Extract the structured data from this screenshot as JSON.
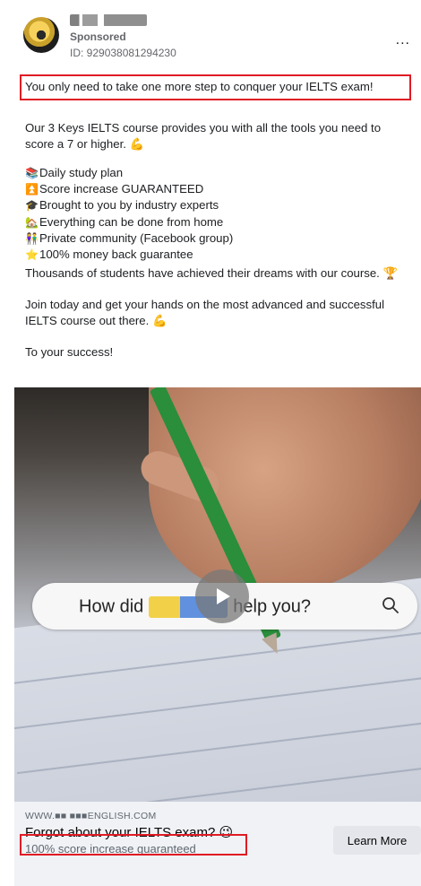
{
  "post": {
    "sponsored": "Sponsored",
    "ad_id": "ID: 929038081294230",
    "more_label": "...",
    "intro": "You only need to take one more step to conquer your IELTS exam!",
    "paragraph1": "Our 3 Keys IELTS course provides you with all the tools you need to score a 7 or higher. 💪",
    "list": [
      {
        "emoji": "📚",
        "text": "Daily study plan"
      },
      {
        "emoji": "⏫",
        "text": "Score increase GUARANTEED"
      },
      {
        "emoji": "🎓",
        "text": "Brought to you by industry experts"
      },
      {
        "emoji": "🏡",
        "text": "Everything can be done from home"
      },
      {
        "emoji": "👫",
        "text": "Private community (Facebook group)"
      },
      {
        "emoji": "⭐",
        "text": "100% money back guarantee"
      }
    ],
    "paragraph2": "Thousands of students have achieved their dreams with our course. 🏆",
    "paragraph3": "Join today and get your hands on the most advanced and successful IELTS course out there. 💪",
    "paragraph4": "To your success!"
  },
  "media": {
    "search_prefix": "How did",
    "search_suffix": "help you?"
  },
  "cta": {
    "domain": "WWW.■■ ■■■ENGLISH.COM",
    "headline": "Forgot about your IELTS exam? 😉",
    "description": "100% score increase guaranteed",
    "button_label": "Learn More"
  },
  "colors": {
    "highlight_border": "#e01b24",
    "button_bg": "#e4e6eb",
    "footer_bg": "#f0f2f5"
  }
}
